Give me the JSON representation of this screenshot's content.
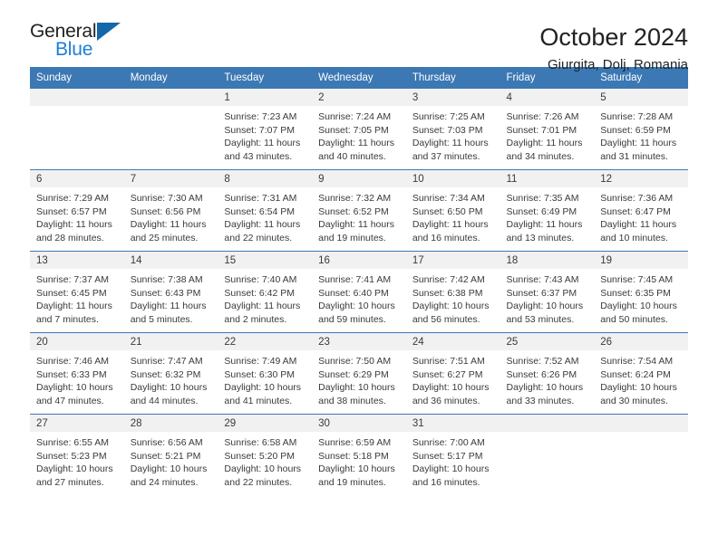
{
  "brand": {
    "name_part1": "General",
    "name_part2": "Blue",
    "triangle_color": "#1467a8",
    "blue_color": "#1b7fd4"
  },
  "header": {
    "title": "October 2024",
    "location": "Giurgita, Dolj, Romania"
  },
  "theme": {
    "header_row_bg": "#3b78b4",
    "daynum_band_bg": "#f1f1f1",
    "row_divider": "#3b78b4",
    "text_color": "#3a3a3a"
  },
  "weekday_headers": [
    "Sunday",
    "Monday",
    "Tuesday",
    "Wednesday",
    "Thursday",
    "Friday",
    "Saturday"
  ],
  "labels": {
    "sunrise_prefix": "Sunrise:",
    "sunset_prefix": "Sunset:",
    "daylight_prefix": "Daylight:"
  },
  "weeks": [
    [
      {
        "day": "",
        "blank": true
      },
      {
        "day": "",
        "blank": true
      },
      {
        "day": "1",
        "sunrise": "Sunrise: 7:23 AM",
        "sunset": "Sunset: 7:07 PM",
        "daylight_line1": "Daylight: 11 hours",
        "daylight_line2": "and 43 minutes."
      },
      {
        "day": "2",
        "sunrise": "Sunrise: 7:24 AM",
        "sunset": "Sunset: 7:05 PM",
        "daylight_line1": "Daylight: 11 hours",
        "daylight_line2": "and 40 minutes."
      },
      {
        "day": "3",
        "sunrise": "Sunrise: 7:25 AM",
        "sunset": "Sunset: 7:03 PM",
        "daylight_line1": "Daylight: 11 hours",
        "daylight_line2": "and 37 minutes."
      },
      {
        "day": "4",
        "sunrise": "Sunrise: 7:26 AM",
        "sunset": "Sunset: 7:01 PM",
        "daylight_line1": "Daylight: 11 hours",
        "daylight_line2": "and 34 minutes."
      },
      {
        "day": "5",
        "sunrise": "Sunrise: 7:28 AM",
        "sunset": "Sunset: 6:59 PM",
        "daylight_line1": "Daylight: 11 hours",
        "daylight_line2": "and 31 minutes."
      }
    ],
    [
      {
        "day": "6",
        "sunrise": "Sunrise: 7:29 AM",
        "sunset": "Sunset: 6:57 PM",
        "daylight_line1": "Daylight: 11 hours",
        "daylight_line2": "and 28 minutes."
      },
      {
        "day": "7",
        "sunrise": "Sunrise: 7:30 AM",
        "sunset": "Sunset: 6:56 PM",
        "daylight_line1": "Daylight: 11 hours",
        "daylight_line2": "and 25 minutes."
      },
      {
        "day": "8",
        "sunrise": "Sunrise: 7:31 AM",
        "sunset": "Sunset: 6:54 PM",
        "daylight_line1": "Daylight: 11 hours",
        "daylight_line2": "and 22 minutes."
      },
      {
        "day": "9",
        "sunrise": "Sunrise: 7:32 AM",
        "sunset": "Sunset: 6:52 PM",
        "daylight_line1": "Daylight: 11 hours",
        "daylight_line2": "and 19 minutes."
      },
      {
        "day": "10",
        "sunrise": "Sunrise: 7:34 AM",
        "sunset": "Sunset: 6:50 PM",
        "daylight_line1": "Daylight: 11 hours",
        "daylight_line2": "and 16 minutes."
      },
      {
        "day": "11",
        "sunrise": "Sunrise: 7:35 AM",
        "sunset": "Sunset: 6:49 PM",
        "daylight_line1": "Daylight: 11 hours",
        "daylight_line2": "and 13 minutes."
      },
      {
        "day": "12",
        "sunrise": "Sunrise: 7:36 AM",
        "sunset": "Sunset: 6:47 PM",
        "daylight_line1": "Daylight: 11 hours",
        "daylight_line2": "and 10 minutes."
      }
    ],
    [
      {
        "day": "13",
        "sunrise": "Sunrise: 7:37 AM",
        "sunset": "Sunset: 6:45 PM",
        "daylight_line1": "Daylight: 11 hours",
        "daylight_line2": "and 7 minutes."
      },
      {
        "day": "14",
        "sunrise": "Sunrise: 7:38 AM",
        "sunset": "Sunset: 6:43 PM",
        "daylight_line1": "Daylight: 11 hours",
        "daylight_line2": "and 5 minutes."
      },
      {
        "day": "15",
        "sunrise": "Sunrise: 7:40 AM",
        "sunset": "Sunset: 6:42 PM",
        "daylight_line1": "Daylight: 11 hours",
        "daylight_line2": "and 2 minutes."
      },
      {
        "day": "16",
        "sunrise": "Sunrise: 7:41 AM",
        "sunset": "Sunset: 6:40 PM",
        "daylight_line1": "Daylight: 10 hours",
        "daylight_line2": "and 59 minutes."
      },
      {
        "day": "17",
        "sunrise": "Sunrise: 7:42 AM",
        "sunset": "Sunset: 6:38 PM",
        "daylight_line1": "Daylight: 10 hours",
        "daylight_line2": "and 56 minutes."
      },
      {
        "day": "18",
        "sunrise": "Sunrise: 7:43 AM",
        "sunset": "Sunset: 6:37 PM",
        "daylight_line1": "Daylight: 10 hours",
        "daylight_line2": "and 53 minutes."
      },
      {
        "day": "19",
        "sunrise": "Sunrise: 7:45 AM",
        "sunset": "Sunset: 6:35 PM",
        "daylight_line1": "Daylight: 10 hours",
        "daylight_line2": "and 50 minutes."
      }
    ],
    [
      {
        "day": "20",
        "sunrise": "Sunrise: 7:46 AM",
        "sunset": "Sunset: 6:33 PM",
        "daylight_line1": "Daylight: 10 hours",
        "daylight_line2": "and 47 minutes."
      },
      {
        "day": "21",
        "sunrise": "Sunrise: 7:47 AM",
        "sunset": "Sunset: 6:32 PM",
        "daylight_line1": "Daylight: 10 hours",
        "daylight_line2": "and 44 minutes."
      },
      {
        "day": "22",
        "sunrise": "Sunrise: 7:49 AM",
        "sunset": "Sunset: 6:30 PM",
        "daylight_line1": "Daylight: 10 hours",
        "daylight_line2": "and 41 minutes."
      },
      {
        "day": "23",
        "sunrise": "Sunrise: 7:50 AM",
        "sunset": "Sunset: 6:29 PM",
        "daylight_line1": "Daylight: 10 hours",
        "daylight_line2": "and 38 minutes."
      },
      {
        "day": "24",
        "sunrise": "Sunrise: 7:51 AM",
        "sunset": "Sunset: 6:27 PM",
        "daylight_line1": "Daylight: 10 hours",
        "daylight_line2": "and 36 minutes."
      },
      {
        "day": "25",
        "sunrise": "Sunrise: 7:52 AM",
        "sunset": "Sunset: 6:26 PM",
        "daylight_line1": "Daylight: 10 hours",
        "daylight_line2": "and 33 minutes."
      },
      {
        "day": "26",
        "sunrise": "Sunrise: 7:54 AM",
        "sunset": "Sunset: 6:24 PM",
        "daylight_line1": "Daylight: 10 hours",
        "daylight_line2": "and 30 minutes."
      }
    ],
    [
      {
        "day": "27",
        "sunrise": "Sunrise: 6:55 AM",
        "sunset": "Sunset: 5:23 PM",
        "daylight_line1": "Daylight: 10 hours",
        "daylight_line2": "and 27 minutes."
      },
      {
        "day": "28",
        "sunrise": "Sunrise: 6:56 AM",
        "sunset": "Sunset: 5:21 PM",
        "daylight_line1": "Daylight: 10 hours",
        "daylight_line2": "and 24 minutes."
      },
      {
        "day": "29",
        "sunrise": "Sunrise: 6:58 AM",
        "sunset": "Sunset: 5:20 PM",
        "daylight_line1": "Daylight: 10 hours",
        "daylight_line2": "and 22 minutes."
      },
      {
        "day": "30",
        "sunrise": "Sunrise: 6:59 AM",
        "sunset": "Sunset: 5:18 PM",
        "daylight_line1": "Daylight: 10 hours",
        "daylight_line2": "and 19 minutes."
      },
      {
        "day": "31",
        "sunrise": "Sunrise: 7:00 AM",
        "sunset": "Sunset: 5:17 PM",
        "daylight_line1": "Daylight: 10 hours",
        "daylight_line2": "and 16 minutes."
      },
      {
        "day": "",
        "blank": true
      },
      {
        "day": "",
        "blank": true
      }
    ]
  ]
}
